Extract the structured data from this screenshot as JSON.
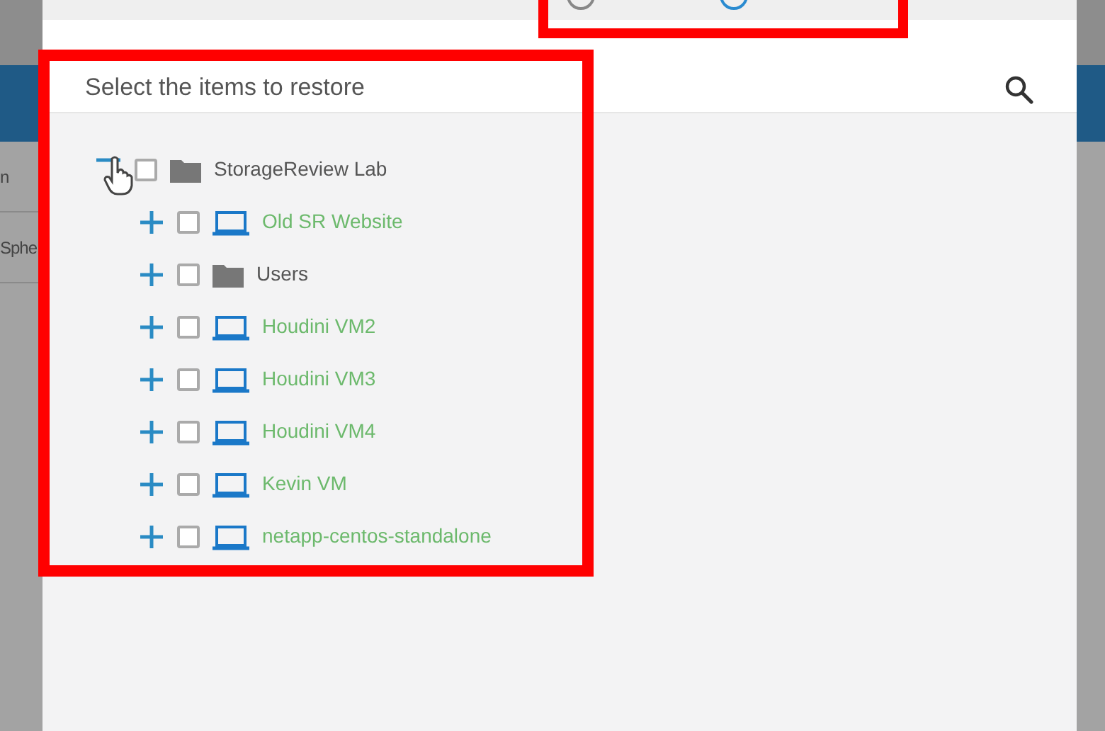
{
  "background_page": {
    "texts": [
      "n",
      "Sphe"
    ]
  },
  "mode_options": [
    {
      "selected": false
    },
    {
      "selected": true
    }
  ],
  "panel": {
    "title": "Select the items to restore"
  },
  "tree": [
    {
      "label": "StorageReview Lab",
      "kind": "folder",
      "expanded": true,
      "checked": false,
      "children": [
        {
          "label": "Old SR Website",
          "kind": "vm",
          "expanded": false,
          "checked": false
        },
        {
          "label": "Users",
          "kind": "folder",
          "expanded": false,
          "checked": false
        },
        {
          "label": "Houdini VM2",
          "kind": "vm",
          "expanded": false,
          "checked": false
        },
        {
          "label": "Houdini VM3",
          "kind": "vm",
          "expanded": false,
          "checked": false
        },
        {
          "label": "Houdini VM4",
          "kind": "vm",
          "expanded": false,
          "checked": false
        },
        {
          "label": "Kevin VM",
          "kind": "vm",
          "expanded": false,
          "checked": false
        },
        {
          "label": "netapp-centos-standalone",
          "kind": "vm",
          "expanded": false,
          "checked": false
        }
      ]
    }
  ]
}
